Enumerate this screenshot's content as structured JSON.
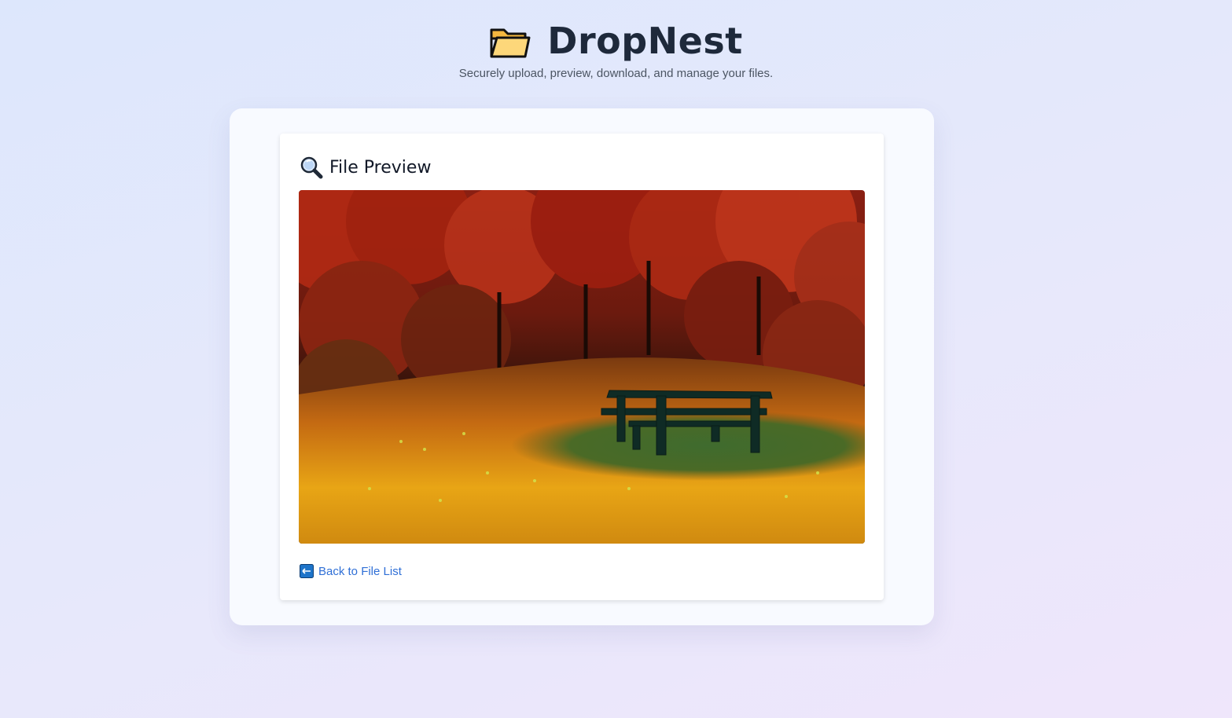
{
  "app": {
    "title": "DropNest",
    "subtitle": "Securely upload, preview, download, and manage your files.",
    "logo_icon": "folder-icon"
  },
  "preview": {
    "heading": "File Preview",
    "heading_icon": "magnifier-icon",
    "image_alt": "Picnic table in an autumn forest clearing"
  },
  "navigation": {
    "back_label": "Back to File List",
    "back_icon": "left-arrow-icon"
  },
  "colors": {
    "background_start": "#dde7fc",
    "background_end": "#efe6fb",
    "link": "#2f6fd6",
    "title": "#1e293b"
  }
}
